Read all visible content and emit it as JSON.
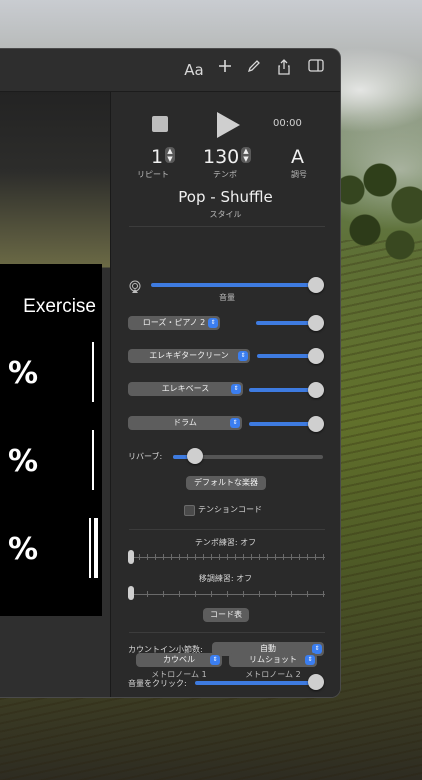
{
  "toolbar": {
    "font_label": "Aa",
    "icons": [
      "font-icon",
      "add-icon",
      "pencil-icon",
      "share-icon",
      "sidebar-icon"
    ]
  },
  "sheet": {
    "title": "Exercise",
    "repeat_sign": "%",
    "measures": 3
  },
  "transport": {
    "time": "00:00",
    "repeat": {
      "value": "1",
      "label": "リピート"
    },
    "tempo": {
      "value": "130",
      "label": "テンポ"
    },
    "key": {
      "value": "A",
      "label": "調号"
    }
  },
  "style": {
    "name": "Pop - Shuffle",
    "label": "スタイル"
  },
  "volume": {
    "label": "音量",
    "level": 1.0
  },
  "instruments": [
    {
      "name": "ローズ・ピアノ 2",
      "level": 1.0
    },
    {
      "name": "エレキギタークリーン",
      "level": 1.0
    },
    {
      "name": "エレキベース",
      "level": 1.0
    },
    {
      "name": "ドラム",
      "level": 1.0
    }
  ],
  "reverb": {
    "label": "リバーブ:",
    "level": 0.1
  },
  "default_instruments_button": "デフォルトな楽器",
  "tension_code": {
    "label": "テンションコード",
    "checked": false
  },
  "tempo_practice": {
    "label": "テンポ練習: オフ"
  },
  "transpose_practice": {
    "label": "移調練習: オフ"
  },
  "chord_chart_button": "コード表",
  "count_in": {
    "label": "カウントイン小節数:",
    "value": "自動"
  },
  "click_volume": {
    "label": "音量をクリック:",
    "level": 1.0
  },
  "metronome1": {
    "value": "カウベル",
    "label": "メトロノーム 1"
  },
  "metronome2": {
    "value": "リムショット",
    "label": "メトロノーム 2"
  },
  "colors": {
    "accent": "#3e7be0",
    "panel": "#2a2a2a"
  }
}
